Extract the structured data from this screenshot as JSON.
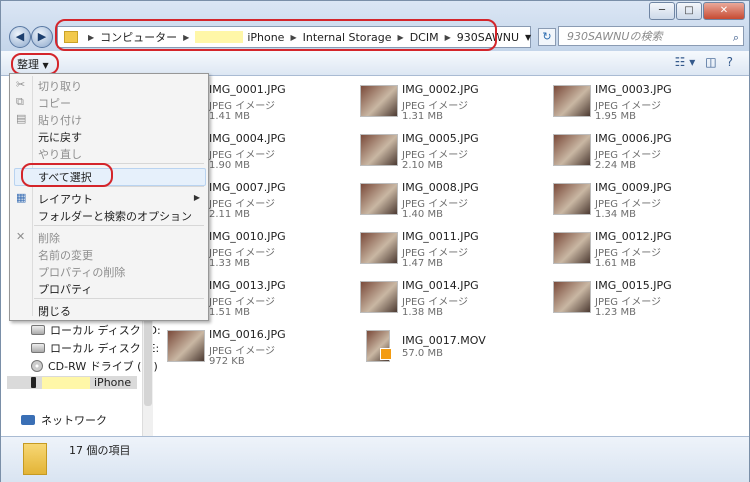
{
  "window": {
    "caption_minimize": "─",
    "caption_maximize": "□",
    "caption_close": "✕"
  },
  "nav": {
    "back": "◀",
    "forward": "▶"
  },
  "address": {
    "segments": [
      "コンピューター",
      "iPhone",
      "Internal Storage",
      "DCIM",
      "930SAWNU"
    ]
  },
  "search": {
    "placeholder": "930SAWNUの検索"
  },
  "toolbar": {
    "organize_label": "整理"
  },
  "menu": {
    "items": [
      {
        "label": "切り取り"
      },
      {
        "label": "コピー"
      },
      {
        "label": "貼り付け"
      },
      {
        "label": "元に戻す"
      },
      {
        "label": "やり直し"
      },
      {
        "label": "すべて選択"
      },
      {
        "label": "レイアウト"
      },
      {
        "label": "フォルダーと検索のオプション"
      },
      {
        "label": "削除"
      },
      {
        "label": "名前の変更"
      },
      {
        "label": "プロパティの削除"
      },
      {
        "label": "プロパティ"
      },
      {
        "label": "閉じる"
      }
    ]
  },
  "sidebar": {
    "items": [
      {
        "label": "ローカル ディスク (D:"
      },
      {
        "label": "ローカル ディスク (E:"
      },
      {
        "label": "CD-RW ドライブ (H:)"
      },
      {
        "label": "iPhone"
      },
      {
        "label": "ネットワーク"
      }
    ]
  },
  "files": [
    {
      "name": "IMG_0001.JPG",
      "type": "JPEG イメージ",
      "size": "1.41 MB"
    },
    {
      "name": "IMG_0002.JPG",
      "type": "JPEG イメージ",
      "size": "1.31 MB"
    },
    {
      "name": "IMG_0003.JPG",
      "type": "JPEG イメージ",
      "size": "1.95 MB"
    },
    {
      "name": "IMG_0004.JPG",
      "type": "JPEG イメージ",
      "size": "1.90 MB"
    },
    {
      "name": "IMG_0005.JPG",
      "type": "JPEG イメージ",
      "size": "2.10 MB"
    },
    {
      "name": "IMG_0006.JPG",
      "type": "JPEG イメージ",
      "size": "2.24 MB"
    },
    {
      "name": "IMG_0007.JPG",
      "type": "JPEG イメージ",
      "size": "2.11 MB"
    },
    {
      "name": "IMG_0008.JPG",
      "type": "JPEG イメージ",
      "size": "1.40 MB"
    },
    {
      "name": "IMG_0009.JPG",
      "type": "JPEG イメージ",
      "size": "1.34 MB"
    },
    {
      "name": "IMG_0010.JPG",
      "type": "JPEG イメージ",
      "size": "1.33 MB"
    },
    {
      "name": "IMG_0011.JPG",
      "type": "JPEG イメージ",
      "size": "1.47 MB"
    },
    {
      "name": "IMG_0012.JPG",
      "type": "JPEG イメージ",
      "size": "1.61 MB"
    },
    {
      "name": "IMG_0013.JPG",
      "type": "JPEG イメージ",
      "size": "1.51 MB"
    },
    {
      "name": "IMG_0014.JPG",
      "type": "JPEG イメージ",
      "size": "1.38 MB"
    },
    {
      "name": "IMG_0015.JPG",
      "type": "JPEG イメージ",
      "size": "1.23 MB"
    },
    {
      "name": "IMG_0016.JPG",
      "type": "JPEG イメージ",
      "size": "972 KB"
    },
    {
      "name": "IMG_0017.MOV",
      "type": "",
      "size": "57.0 MB"
    }
  ],
  "status": {
    "item_count": "17 個の項目"
  },
  "colors": {
    "highlight_ring": "#d4252b",
    "chrome": "#c4d5ea"
  }
}
